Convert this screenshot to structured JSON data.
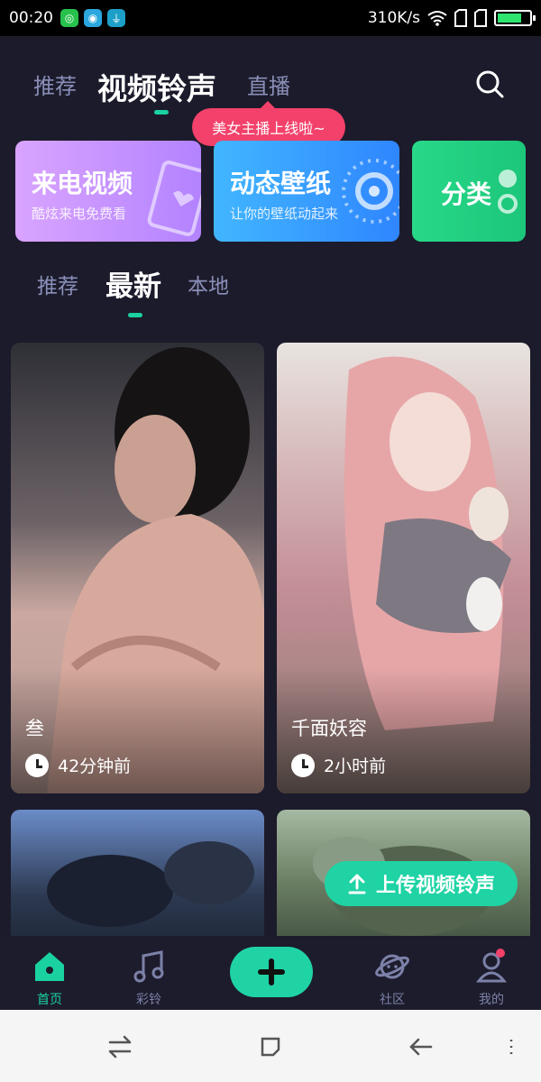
{
  "status_bar": {
    "time": "00:20",
    "speed": "310K/s",
    "battery_level": 0.75
  },
  "top_tabs": {
    "items": [
      "推荐",
      "视频铃声",
      "直播"
    ],
    "active": "视频铃声",
    "search_icon": "search-icon",
    "live_bubble": "美女主播上线啦~"
  },
  "feature_cards": [
    {
      "title": "来电视频",
      "subtitle": "酷炫来电免费看",
      "color": "#c794ff"
    },
    {
      "title": "动态壁纸",
      "subtitle": "让你的壁纸动起来",
      "color": "#3aa3ff"
    },
    {
      "title": "分类",
      "subtitle": "",
      "color": "#22cf80"
    }
  ],
  "sub_tabs": {
    "items": [
      "推荐",
      "最新",
      "本地"
    ],
    "active": "最新"
  },
  "videos": [
    {
      "title": "叁",
      "time": "42分钟前"
    },
    {
      "title": "千面妖容",
      "time": "2小时前"
    },
    {
      "title": "",
      "time": ""
    },
    {
      "title": "",
      "time": ""
    }
  ],
  "upload_button": {
    "label": "上传视频铃声",
    "icon": "upload-arrow-icon"
  },
  "bottom_nav": [
    {
      "label": "首页",
      "icon": "home-icon",
      "active": true
    },
    {
      "label": "彩铃",
      "icon": "music-note-icon",
      "active": false
    },
    {
      "label": "",
      "icon": "plus-icon",
      "active": false
    },
    {
      "label": "社区",
      "icon": "planet-icon",
      "active": false
    },
    {
      "label": "我的",
      "icon": "profile-icon",
      "active": false
    }
  ],
  "system_nav": [
    "switch-icon",
    "home-square-icon",
    "back-icon",
    "menu-dots-icon"
  ],
  "colors": {
    "accent": "#1ad1a0",
    "background": "#1c1b2b",
    "inactive_tab": "#8a8fb8",
    "live_bubble": "#f2416a"
  }
}
